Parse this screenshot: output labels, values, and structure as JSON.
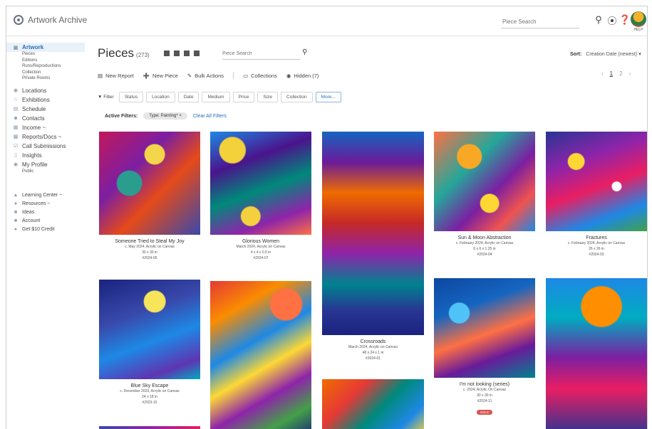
{
  "app": {
    "name": "Artwork Archive"
  },
  "topbar": {
    "search_placeholder": "Piece Search",
    "avatar_label": "HELP"
  },
  "sidebar": {
    "artwork": "Artwork",
    "sub_items": [
      "Pieces",
      "Editions",
      "Runs/Reproductions",
      "Collection",
      "Private Rooms"
    ],
    "main_items": [
      {
        "label": "Locations",
        "icon": "location-icon"
      },
      {
        "label": "Exhibitions",
        "icon": "exhibitions-icon"
      },
      {
        "label": "Schedule",
        "icon": "calendar-icon"
      },
      {
        "label": "Contacts",
        "icon": "contacts-icon"
      },
      {
        "label": "Income  ~",
        "icon": "income-icon"
      },
      {
        "label": "Reports/Docs  ~",
        "icon": "reports-icon"
      },
      {
        "label": "Call Submissions",
        "icon": "submissions-icon"
      },
      {
        "label": "Insights",
        "icon": "insights-icon"
      },
      {
        "label": "My Profile",
        "icon": "profile-icon"
      }
    ],
    "profile_sub": "Public",
    "bottom_items": [
      {
        "label": "Learning Center  ~",
        "icon": "learning-icon"
      },
      {
        "label": "Resources  ~",
        "icon": "resources-icon"
      },
      {
        "label": "Ideas",
        "icon": "ideas-icon"
      },
      {
        "label": "Account",
        "icon": "account-icon"
      },
      {
        "label": "Get $10 Credit",
        "icon": "credit-icon"
      }
    ]
  },
  "header": {
    "title": "Pieces",
    "count": "(273)",
    "search_placeholder": "Piece Search",
    "sort_label": "Sort:",
    "sort_value": "Creation Date (newest)  ▾"
  },
  "pager": {
    "prev": "‹",
    "page1": "1",
    "page2": "2",
    "next": "›"
  },
  "actions": [
    "New Report",
    "New Piece",
    "Bulk Actions",
    "Collections",
    "Hidden (7)"
  ],
  "filters": {
    "label": "Filter",
    "chips": [
      "Status",
      "Location",
      "Date",
      "Medium",
      "Price",
      "Size",
      "Collection",
      "More..."
    ]
  },
  "active_filters": {
    "label": "Active Filters:",
    "pill": "Type: Painting*  ×",
    "clear": "Clear All Filters"
  },
  "pieces": [
    {
      "title": "Someone Tried to Steal My Joy",
      "l1": "c. May 2024, Acrylic on Canvas",
      "l2": "30 x 30 in",
      "l3": "#2024-05"
    },
    {
      "title": "Glorious Women",
      "l1": "March 2024, Acrylic on Canvas",
      "l2": "4 x 4 x 0.5 in",
      "l3": "#2024-07"
    },
    {
      "title": "Crossroads",
      "l1": "March 2024, Acrylic on Canvas",
      "l2": "48 x 24 x 1 in",
      "l3": "#2024-01"
    },
    {
      "title": "Sun & Moon Abstraction",
      "l1": "c. February 2024, Acrylic on Canvas",
      "l2": "6 x 6 x 1.25 in",
      "l3": "#2024-04"
    },
    {
      "title": "Fractures",
      "l1": "c. February 2024, Acrylic on Canvas",
      "l2": "26 x 26 in",
      "l3": "#2024-03"
    },
    {
      "title": "Blue Sky Escape",
      "l1": "c. December 2023, Acrylic on Canvas",
      "l2": "24 x 18 in",
      "l3": "#2023-15"
    },
    {
      "title": "I'm not looking (series)",
      "l1": "c. 2024, Acrylic On Canvas",
      "l2": "30 x 30 in",
      "l3": "#2024-11",
      "tag": "SOLD"
    }
  ],
  "colors": {
    "accent": "#2a6ebb",
    "sold": "#d9534f",
    "active_bg": "#e9f1f9"
  }
}
